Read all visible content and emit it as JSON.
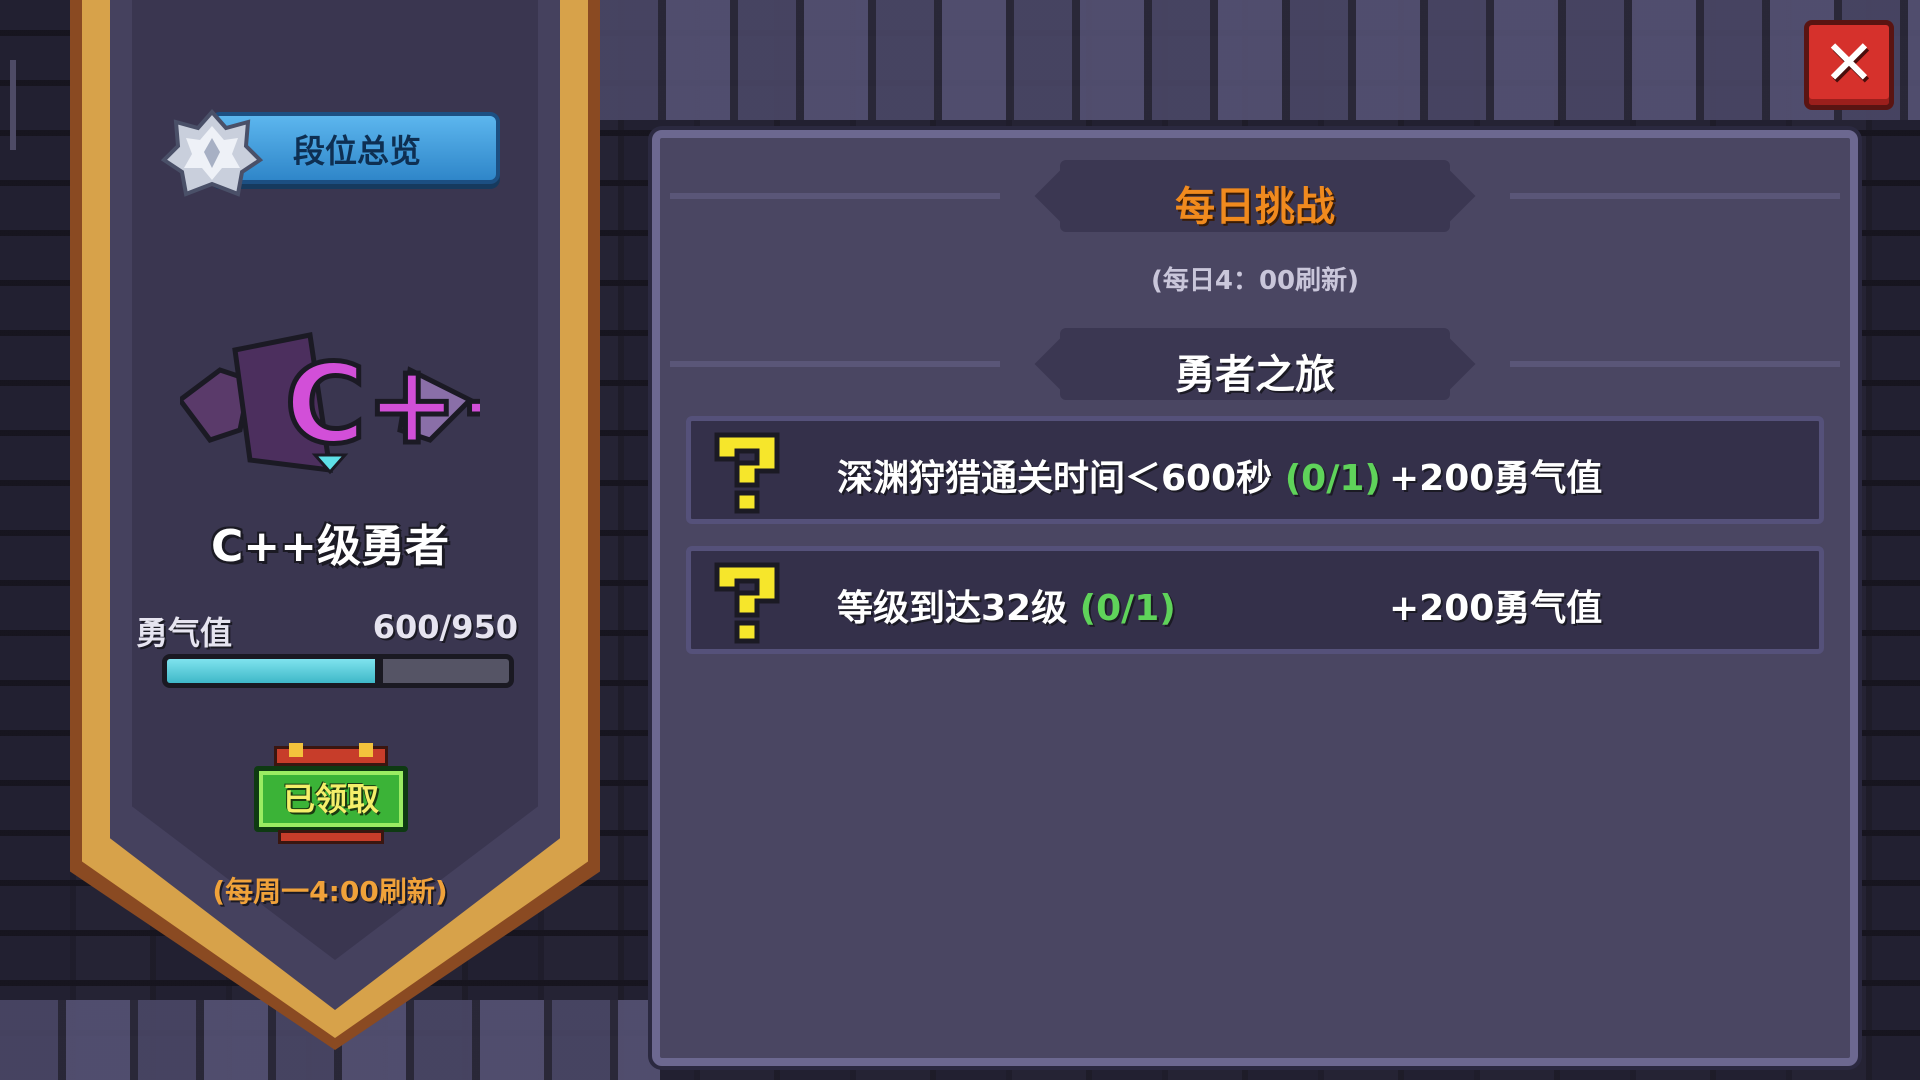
{
  "rank_panel": {
    "overview_button_label": "段位总览",
    "rank_emblem_text": "C++",
    "rank_title": "C++级勇者",
    "courage_label": "勇气值",
    "courage_value": "600/950",
    "courage_progress_fraction": 0.6316,
    "chest_status_label": "已领取",
    "weekly_refresh_note": "(每周一4:00刷新)"
  },
  "daily_challenge": {
    "title": "每日挑战",
    "refresh_note": "(每日4：00刷新)",
    "section_title": "勇者之旅",
    "tasks": [
      {
        "icon": "question-mark-icon",
        "description": "深渊狩猎通关时间＜600秒",
        "progress": "(0/1)",
        "reward": "+200勇气值"
      },
      {
        "icon": "question-mark-icon",
        "description": "等级到达32级",
        "progress": "(0/1)",
        "reward": "+200勇气值"
      }
    ]
  },
  "close_button_label": "✕",
  "colors": {
    "accent_orange": "#f08a1e",
    "progress_green": "#5fd35a",
    "bar_cyan": "#5fd0de",
    "close_red": "#d6312c",
    "overview_blue": "#3e9ad8"
  }
}
